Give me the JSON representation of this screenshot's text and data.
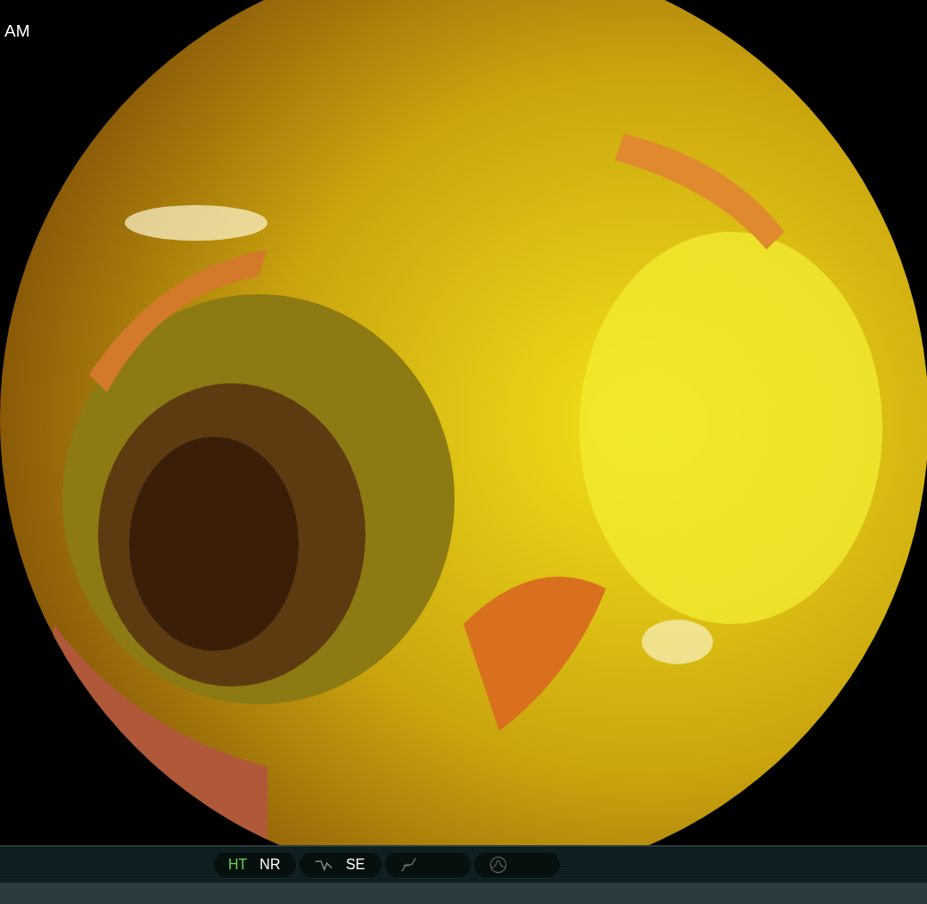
{
  "overlay": {
    "top_left": "AM"
  },
  "status_bar": {
    "groups": [
      {
        "kind": "text",
        "items": [
          {
            "label": "HT",
            "on": true
          },
          {
            "label": "NR",
            "on": false
          }
        ]
      },
      {
        "kind": "icon-text",
        "label": "SE"
      },
      {
        "kind": "icon"
      },
      {
        "kind": "wave-icon"
      }
    ]
  }
}
